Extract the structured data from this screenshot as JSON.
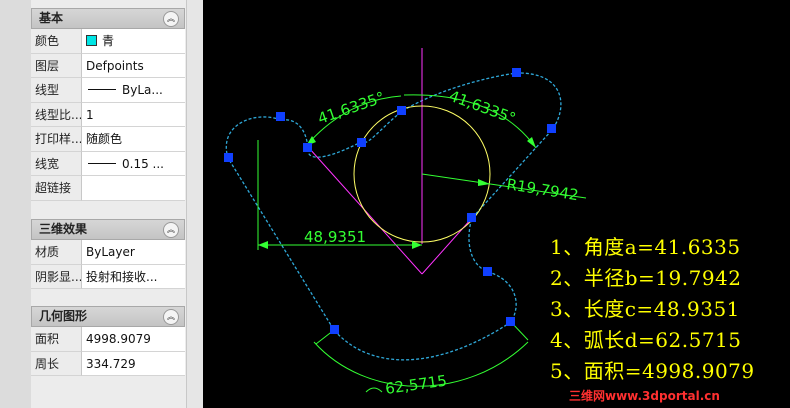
{
  "palette": {
    "basic": {
      "title": "基本",
      "rows": [
        {
          "label": "颜色",
          "value": "青"
        },
        {
          "label": "图层",
          "value": "Defpoints"
        },
        {
          "label": "线型",
          "value": "ByLa..."
        },
        {
          "label": "线型比...",
          "value": "1"
        },
        {
          "label": "打印样...",
          "value": "随颜色"
        },
        {
          "label": "线宽",
          "value": "0.15 ..."
        },
        {
          "label": "超链接",
          "value": ""
        }
      ]
    },
    "three_d": {
      "title": "三维效果",
      "rows": [
        {
          "label": "材质",
          "value": "ByLayer"
        },
        {
          "label": "阴影显...",
          "value": "投射和接收..."
        }
      ]
    },
    "geometry": {
      "title": "几何图形",
      "rows": [
        {
          "label": "面积",
          "value": "4998.9079"
        },
        {
          "label": "周长",
          "value": "334.729"
        }
      ]
    }
  },
  "colors": {
    "spline": "#2fa8d8",
    "grip": "#1040ff",
    "dimension": "#33ff33",
    "circle": "#ffff66",
    "magenta": "#ff33ff",
    "result_text": "#ffff00",
    "color_swatch": "#00e5e5"
  },
  "drawing": {
    "dims": {
      "angle_left": "41,6335°",
      "angle_right": "41,6335°",
      "radius": "R19,7942",
      "length": "48,9351",
      "arc": "62,5715"
    },
    "results": [
      "1、角度a=41.6335",
      "2、半径b=19.7942",
      "3、长度c=48.9351",
      "4、弧长d=62.5715",
      "5、面积=4998.9079"
    ],
    "watermark": "三维网www.3dportal.cn"
  }
}
